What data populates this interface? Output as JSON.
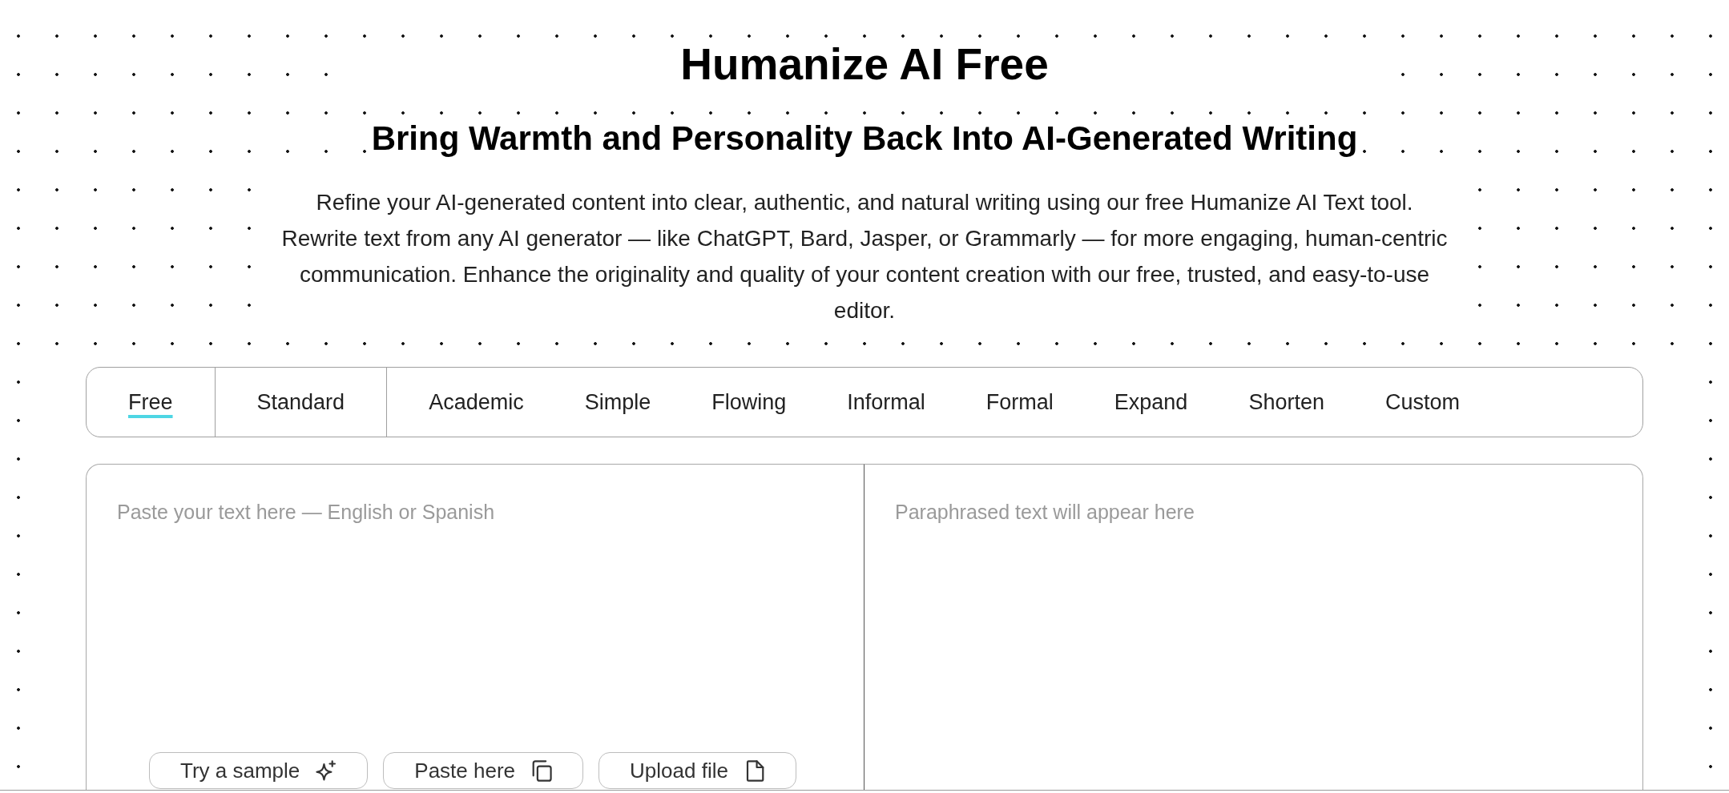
{
  "header": {
    "title": "Humanize AI Free",
    "subtitle": "Bring Warmth and Personality Back Into AI-Generated Writing",
    "intro": "Refine your AI-generated content into clear, authentic, and natural writing using our free Humanize AI Text tool. Rewrite text from any AI generator — like ChatGPT, Bard, Jasper, or Grammarly — for more engaging, human-centric communication. Enhance the originality and quality of your content creation with our free, trusted, and easy-to-use editor."
  },
  "tab_groups": [
    {
      "tabs": [
        {
          "label": "Free",
          "selected": true
        }
      ]
    },
    {
      "tabs": [
        {
          "label": "Standard",
          "selected": false
        }
      ]
    },
    {
      "tabs": [
        {
          "label": "Academic",
          "selected": false
        },
        {
          "label": "Simple",
          "selected": false
        },
        {
          "label": "Flowing",
          "selected": false
        },
        {
          "label": "Informal",
          "selected": false
        },
        {
          "label": "Formal",
          "selected": false
        },
        {
          "label": "Expand",
          "selected": false
        },
        {
          "label": "Shorten",
          "selected": false
        },
        {
          "label": "Custom",
          "selected": false
        }
      ]
    }
  ],
  "editor": {
    "input": {
      "placeholder": "Paste your text here — English or Spanish"
    },
    "output": {
      "placeholder": "Paraphrased text will appear here"
    },
    "actions": [
      {
        "kind": "sample",
        "label": "Try a sample"
      },
      {
        "kind": "paste",
        "label": "Paste here"
      },
      {
        "kind": "upload",
        "label": "Upload file"
      }
    ]
  }
}
